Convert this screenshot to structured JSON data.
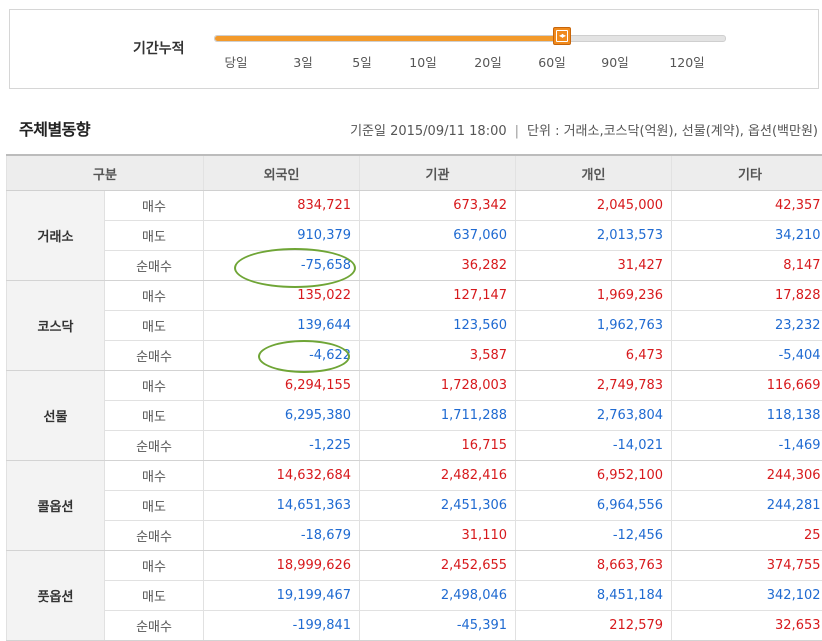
{
  "period": {
    "label": "기간누적",
    "ticks": [
      "당일",
      "3일",
      "5일",
      "10일",
      "20일",
      "60일",
      "90일",
      "120일"
    ],
    "selected": "60일"
  },
  "section": {
    "title": "주체별동향",
    "base_date": "기준일 2015/09/11 18:00",
    "unit": "단위 : 거래소,코스닥(억원), 선물(계약), 옵션(백만원)"
  },
  "table": {
    "headers": [
      "구분",
      "외국인",
      "기관",
      "개인",
      "기타"
    ],
    "groups": [
      {
        "name": "거래소",
        "rows": [
          {
            "label": "매수",
            "values": [
              "834,721",
              "673,342",
              "2,045,000",
              "42,357"
            ]
          },
          {
            "label": "매도",
            "values": [
              "910,379",
              "637,060",
              "2,013,573",
              "34,210"
            ]
          },
          {
            "label": "순매수",
            "values": [
              "-75,658",
              "36,282",
              "31,427",
              "8,147"
            ]
          }
        ]
      },
      {
        "name": "코스닥",
        "rows": [
          {
            "label": "매수",
            "values": [
              "135,022",
              "127,147",
              "1,969,236",
              "17,828"
            ]
          },
          {
            "label": "매도",
            "values": [
              "139,644",
              "123,560",
              "1,962,763",
              "23,232"
            ]
          },
          {
            "label": "순매수",
            "values": [
              "-4,622",
              "3,587",
              "6,473",
              "-5,404"
            ]
          }
        ]
      },
      {
        "name": "선물",
        "rows": [
          {
            "label": "매수",
            "values": [
              "6,294,155",
              "1,728,003",
              "2,749,783",
              "116,669"
            ]
          },
          {
            "label": "매도",
            "values": [
              "6,295,380",
              "1,711,288",
              "2,763,804",
              "118,138"
            ]
          },
          {
            "label": "순매수",
            "values": [
              "-1,225",
              "16,715",
              "-14,021",
              "-1,469"
            ]
          }
        ]
      },
      {
        "name": "콜옵션",
        "rows": [
          {
            "label": "매수",
            "values": [
              "14,632,684",
              "2,482,416",
              "6,952,100",
              "244,306"
            ]
          },
          {
            "label": "매도",
            "values": [
              "14,651,363",
              "2,451,306",
              "6,964,556",
              "244,281"
            ]
          },
          {
            "label": "순매수",
            "values": [
              "-18,679",
              "31,110",
              "-12,456",
              "25"
            ]
          }
        ]
      },
      {
        "name": "풋옵션",
        "rows": [
          {
            "label": "매수",
            "values": [
              "18,999,626",
              "2,452,655",
              "8,663,763",
              "374,755"
            ]
          },
          {
            "label": "매도",
            "values": [
              "19,199,467",
              "2,498,046",
              "8,451,184",
              "342,102"
            ]
          },
          {
            "label": "순매수",
            "values": [
              "-199,841",
              "-45,391",
              "212,579",
              "32,653"
            ]
          }
        ]
      }
    ]
  },
  "colors": {
    "buy": "#d7191c",
    "sell": "#1f6ad1",
    "accent": "#f39a2b",
    "highlight": "#6fa536"
  }
}
